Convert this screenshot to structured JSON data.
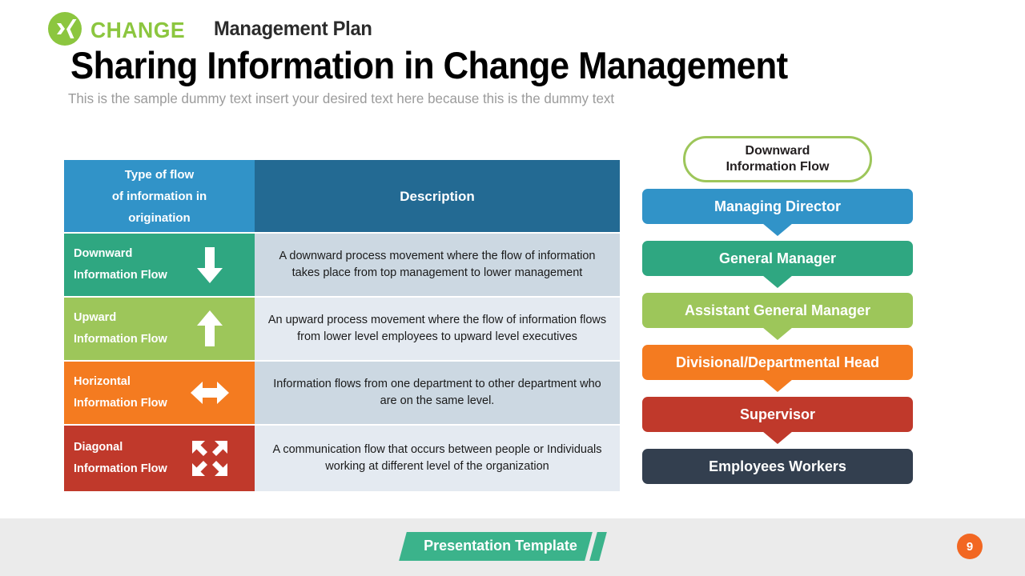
{
  "slide": {
    "title": "Sharing Information in Change Management",
    "subtitle": "This is the sample dummy  text insert your desired text here because this is the dummy  text"
  },
  "table": {
    "header": {
      "type_line1": "Type of flow",
      "type_line2": "of information  in",
      "type_line3": "origination",
      "description": "Description"
    },
    "rows": [
      {
        "type_line1": "Downward",
        "type_line2": "Information Flow",
        "icon": "arrow-down-icon",
        "color": "#2fa781",
        "desc_bg": "#ccd8e2",
        "description": "A downward process movement where the flow of information takes place from top management to lower management"
      },
      {
        "type_line1": "Upward",
        "type_line2": "Information Flow",
        "icon": "arrow-up-icon",
        "color": "#9dc65a",
        "desc_bg": "#e4eaf1",
        "description": "An upward process movement where the flow of information flows from lower level employees to upward level executives"
      },
      {
        "type_line1": "Horizontal",
        "type_line2": "Information Flow",
        "icon": "arrow-left-right-icon",
        "color": "#f47b20",
        "desc_bg": "#ccd8e2",
        "description": "Information flows from one department to other department who are on the same level."
      },
      {
        "type_line1": "Diagonal",
        "type_line2": "Information Flow",
        "icon": "arrow-diagonal-cross-icon",
        "color": "#c0392b",
        "desc_bg": "#e4eaf1",
        "description": "A communication flow that occurs between people or Individuals working at different level of the organization"
      }
    ]
  },
  "flow_chain": {
    "callout_line1": "Downward",
    "callout_line2": "Information Flow",
    "callout_border_color": "#9dc65a",
    "bars": [
      {
        "label": "Managing Director",
        "color": "#3193c8",
        "has_arrow": true
      },
      {
        "label": "General Manager",
        "color": "#2fa781",
        "has_arrow": true
      },
      {
        "label": "Assistant General Manager",
        "color": "#9dc65a",
        "has_arrow": true
      },
      {
        "label": "Divisional/Departmental Head",
        "color": "#f47b20",
        "has_arrow": true
      },
      {
        "label": "Supervisor",
        "color": "#c0392b",
        "has_arrow": true
      },
      {
        "label": "Employees Workers",
        "color": "#333f4f",
        "has_arrow": false
      }
    ]
  },
  "footer": {
    "brand": "CHANGE",
    "plan": "Management Plan",
    "ribbon": "Presentation Template",
    "page_number": "9",
    "brand_color": "#8cc63f",
    "ribbon_color": "#3bb38b",
    "badge_color": "#f26722"
  }
}
